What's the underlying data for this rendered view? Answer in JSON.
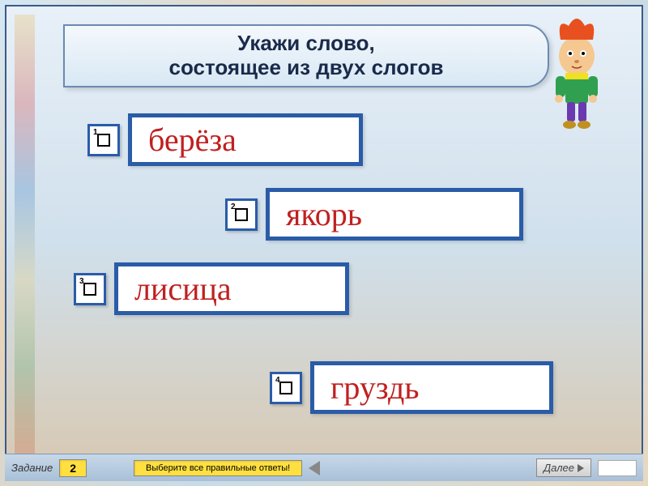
{
  "title": {
    "line1": "Укажи слово,",
    "line2": "состоящее из двух слогов"
  },
  "options": [
    {
      "num": "1",
      "text": "берёза"
    },
    {
      "num": "2",
      "text": "якорь"
    },
    {
      "num": "3",
      "text": "лисица"
    },
    {
      "num": "4",
      "text": "груздь"
    }
  ],
  "footer": {
    "task_label": "Задание",
    "task_num": "2",
    "instruction": "Выберите все правильные ответы!",
    "next_label": "Далее"
  }
}
